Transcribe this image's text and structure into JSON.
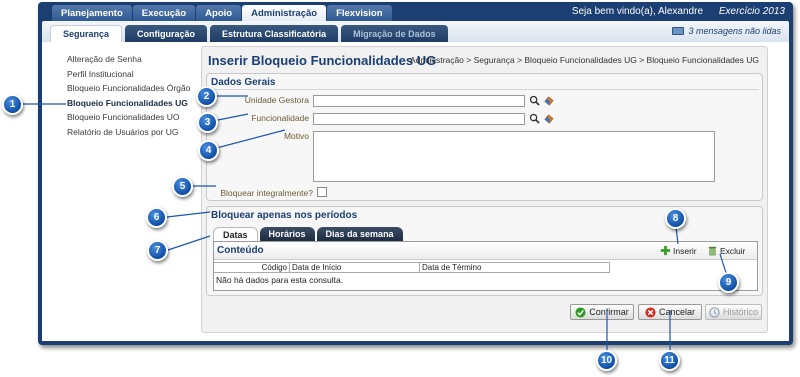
{
  "top_nav": [
    "Planejamento",
    "Execução",
    "Apoio",
    "Administração",
    "Flexvision"
  ],
  "welcome": "Seja bem vindo(a), Alexandre",
  "exercicio": "Exercício 2013",
  "sub_tabs": [
    "Segurança",
    "Configuração",
    "Estrutura Classificatória",
    "Migração de Dados"
  ],
  "messages": "3 mensagens não lidas",
  "left_nav": [
    "Alteração de Senha",
    "Perfil Institucional",
    "Bloqueio Funcionalidades Órgão",
    "Bloqueio Funcionalidades UG",
    "Bloqueio Funcionalidades UO",
    "Relatório de Usuários por UG"
  ],
  "page_title": "Inserir Bloqueio Funcionalidades UG",
  "breadcrumb": "Administração > Segurança > Bloqueio Funcionalidades UG > Bloqueio Funcionalidades UG",
  "dados_gerais": {
    "title": "Dados Gerais",
    "unidade_gestora": "Unidade Gestora",
    "funcionalidade": "Funcionalidade",
    "motivo": "Motivo",
    "bloquear": "Bloquear integralmente?"
  },
  "periodos": {
    "title": "Bloquear apenas nos períodos",
    "tabs": [
      "Datas",
      "Horários",
      "Dias da semana"
    ],
    "grid_title": "Conteúdo",
    "inserir": "Inserir",
    "excluir": "Excluir",
    "columns": [
      "Código",
      "Data de Início",
      "Data de Término"
    ],
    "empty": "Não há dados para esta consulta."
  },
  "actions": {
    "confirmar": "Confirmar",
    "cancelar": "Cancelar",
    "historico": "Histórico"
  },
  "callouts": [
    "1",
    "2",
    "3",
    "4",
    "5",
    "6",
    "7",
    "8",
    "9",
    "10",
    "11"
  ]
}
